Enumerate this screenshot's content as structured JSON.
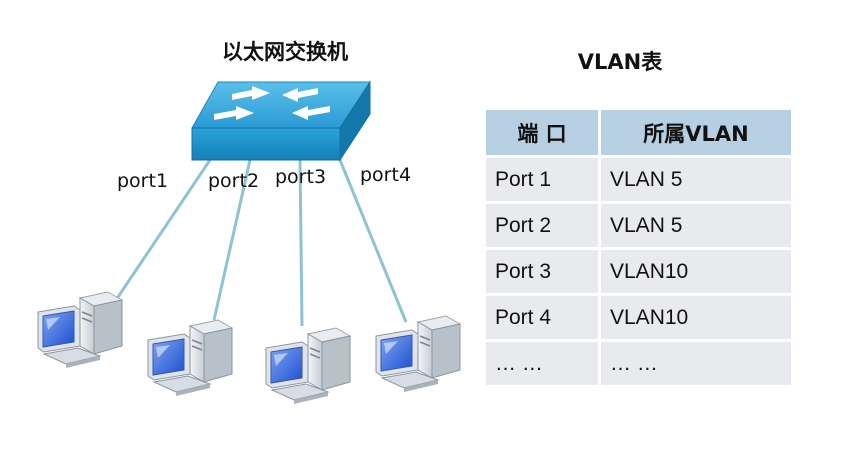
{
  "switch_title": "以太网交换机",
  "table_title": "VLAN表",
  "ports": [
    "port1",
    "port2",
    "port3",
    "port4"
  ],
  "table": {
    "headers": [
      "端 口",
      "所属VLAN"
    ],
    "rows": [
      [
        "Port 1",
        "VLAN 5"
      ],
      [
        "Port 2",
        "VLAN 5"
      ],
      [
        "Port 3",
        "VLAN10"
      ],
      [
        "Port 4",
        "VLAN10"
      ],
      [
        "… …",
        "… …"
      ]
    ]
  },
  "colors": {
    "switch_top": "#3fa9dc",
    "switch_front": "#1a8fc9",
    "cable": "#8ec3d4",
    "header_bg": "#b7cfe3",
    "row_bg": "#e8eaee"
  }
}
